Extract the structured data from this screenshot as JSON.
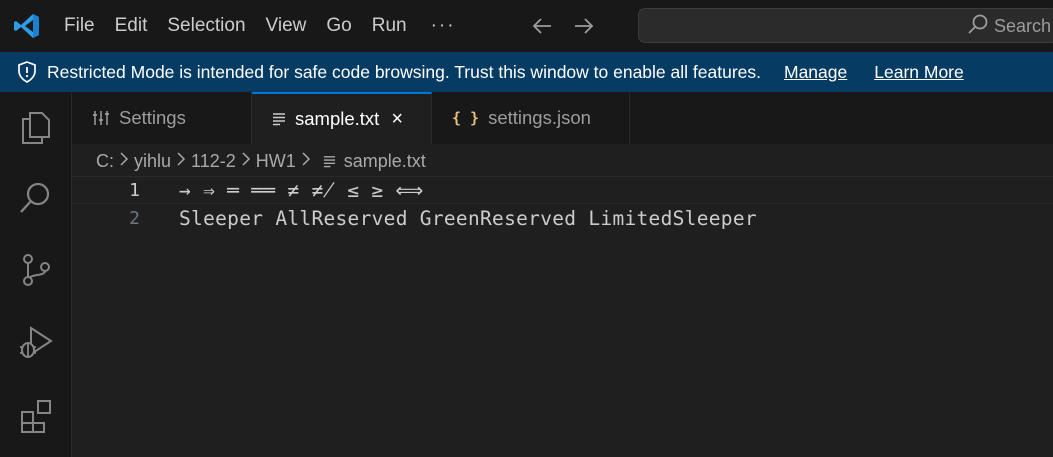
{
  "titlebar": {
    "menu": [
      "File",
      "Edit",
      "Selection",
      "View",
      "Go",
      "Run"
    ],
    "more": "···",
    "search_label": "Search",
    "icons": {
      "logo": "vscode-logo-icon",
      "back": "arrow-left-icon",
      "forward": "arrow-right-icon",
      "search": "search-icon"
    }
  },
  "banner": {
    "text": "Restricted Mode is intended for safe code browsing. Trust this window to enable all features.",
    "manage": "Manage",
    "learn_more": "Learn More",
    "icon": "shield-icon",
    "background": "#063b64"
  },
  "activitybar": {
    "items": [
      "explorer-icon",
      "search-icon",
      "source-control-icon",
      "run-debug-icon",
      "extensions-icon"
    ]
  },
  "tabs": [
    {
      "label": "Settings",
      "icon": "settings-sliders-icon",
      "active": false
    },
    {
      "label": "sample.txt",
      "icon": "text-file-icon",
      "active": true,
      "close": "×"
    },
    {
      "label": "settings.json",
      "icon": "json-braces-icon",
      "active": false
    }
  ],
  "breadcrumb": {
    "parts": [
      "C:",
      "yihlu",
      "112-2",
      "HW1"
    ],
    "file": "sample.txt",
    "separator": ">"
  },
  "editor": {
    "lines": [
      {
        "number": "1",
        "text": "→ ⇒ ═ ══ ≠ ≠̸ ≤ ≥ ⟺"
      },
      {
        "number": "2",
        "text": "Sleeper AllReserved GreenReserved LimitedSleeper"
      }
    ]
  },
  "colors": {
    "accent": "#0078d4",
    "json_icon": "#e5c07b"
  }
}
